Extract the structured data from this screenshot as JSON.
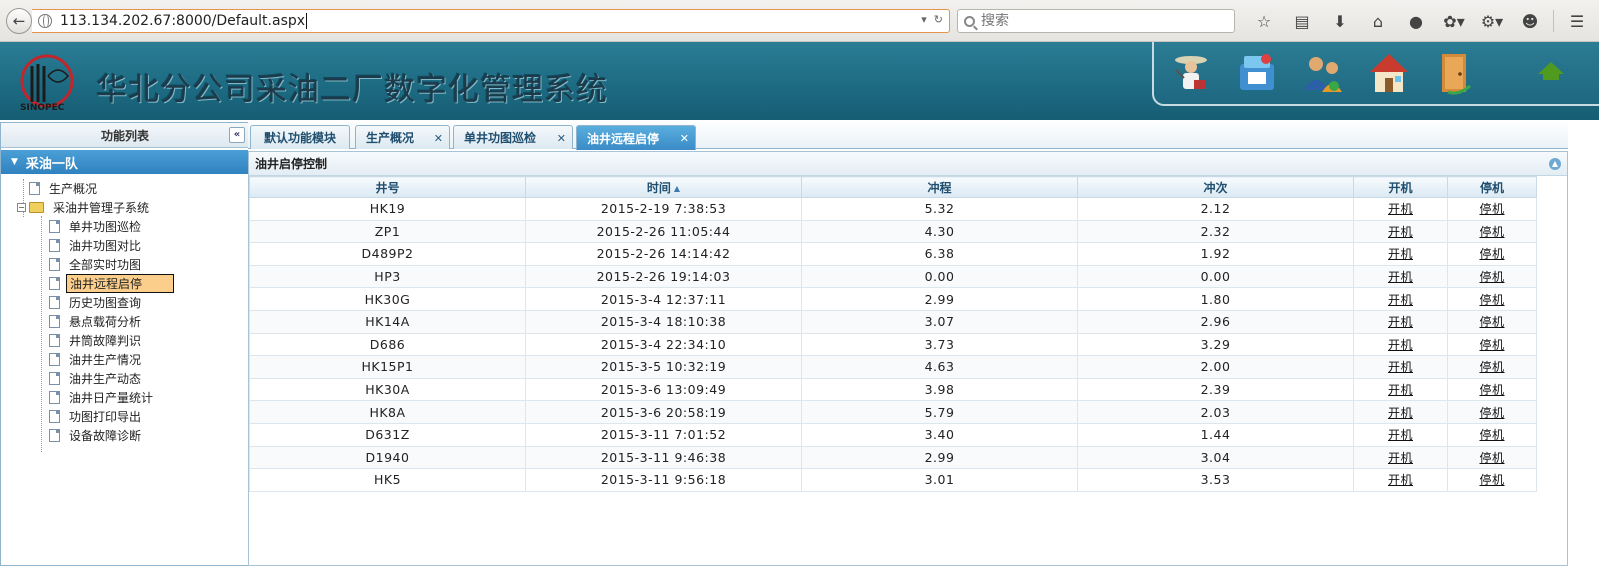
{
  "browser": {
    "url": "113.134.202.67:8000/Default.aspx",
    "search_placeholder": "搜索"
  },
  "header": {
    "logo_text": "SINOPEC",
    "title": "华北分公司采油二厂数字化管理系统"
  },
  "sidebar": {
    "title": "功能列表",
    "group": "采油一队",
    "items": [
      {
        "label": "生产概况"
      },
      {
        "label": "采油井管理子系统"
      },
      {
        "label": "单井功图巡检"
      },
      {
        "label": "油井功图对比"
      },
      {
        "label": "全部实时功图"
      },
      {
        "label": "油井远程启停"
      },
      {
        "label": "历史功图查询"
      },
      {
        "label": "悬点载荷分析"
      },
      {
        "label": "井筒故障判识"
      },
      {
        "label": "油井生产情况"
      },
      {
        "label": "油井生产动态"
      },
      {
        "label": "油井日产量统计"
      },
      {
        "label": "功图打印导出"
      },
      {
        "label": "设备故障诊断"
      }
    ],
    "selected": "油井远程启停"
  },
  "tabs": [
    {
      "label": "默认功能模块"
    },
    {
      "label": "生产概况"
    },
    {
      "label": "单井功图巡检"
    },
    {
      "label": "油井远程启停"
    }
  ],
  "panel": {
    "title": "油井启停控制",
    "columns": [
      "井号",
      "时间",
      "冲程",
      "冲次",
      "开机",
      "停机"
    ],
    "start_label": "开机",
    "stop_label": "停机",
    "rows": [
      [
        "HK19",
        "2015-2-19 7:38:53",
        "5.32",
        "2.12"
      ],
      [
        "ZP1",
        "2015-2-26 11:05:44",
        "4.30",
        "2.32"
      ],
      [
        "D489P2",
        "2015-2-26 14:14:42",
        "6.38",
        "1.92"
      ],
      [
        "HP3",
        "2015-2-26 19:14:03",
        "0.00",
        "0.00"
      ],
      [
        "HK30G",
        "2015-3-4 12:37:11",
        "2.99",
        "1.80"
      ],
      [
        "HK14A",
        "2015-3-4 18:10:38",
        "3.07",
        "2.96"
      ],
      [
        "D686",
        "2015-3-4 22:34:10",
        "3.73",
        "3.29"
      ],
      [
        "HK15P1",
        "2015-3-5 10:32:19",
        "4.63",
        "2.00"
      ],
      [
        "HK30A",
        "2015-3-6 13:09:49",
        "3.98",
        "2.39"
      ],
      [
        "HK8A",
        "2015-3-6 20:58:19",
        "5.79",
        "2.03"
      ],
      [
        "D631Z",
        "2015-3-11 7:01:52",
        "3.40",
        "1.44"
      ],
      [
        "D1940",
        "2015-3-11 9:46:38",
        "2.99",
        "3.04"
      ],
      [
        "HK5",
        "2015-3-11 9:56:18",
        "3.01",
        "3.53"
      ]
    ]
  }
}
